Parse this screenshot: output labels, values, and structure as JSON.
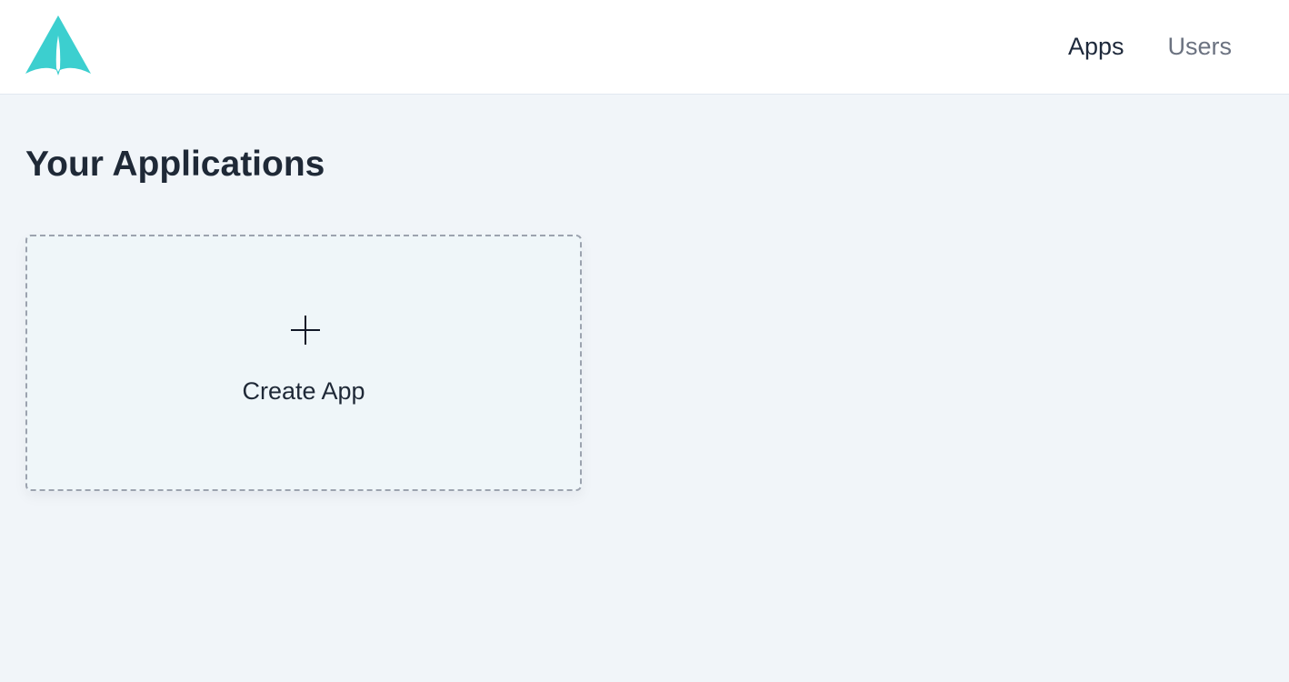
{
  "header": {
    "logo_icon": "rocket-logo-icon",
    "brand_color": "#3ccfcf",
    "nav": [
      {
        "label": "Apps",
        "active": true
      },
      {
        "label": "Users",
        "active": false
      }
    ]
  },
  "main": {
    "title": "Your Applications",
    "create_card": {
      "icon": "plus-icon",
      "label": "Create App"
    }
  }
}
